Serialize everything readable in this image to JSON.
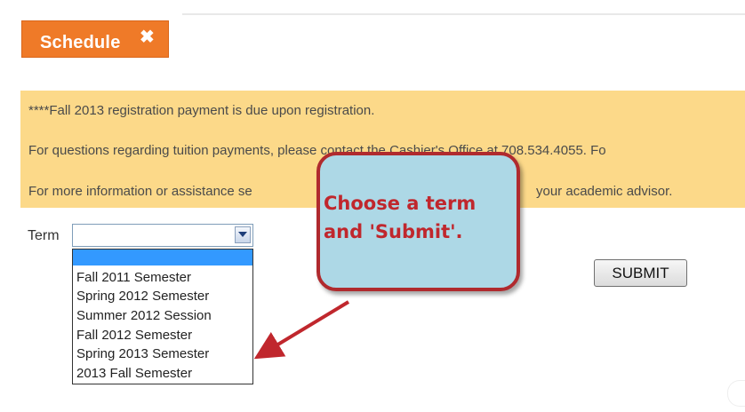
{
  "tab": {
    "label": "Schedule",
    "close_glyph": "✖"
  },
  "notice": {
    "lines": [
      "****Fall 2013 registration payment is due upon registration.",
      "For questions regarding tuition payments, please contact the Cashier's Office at 708.534.4055. Fo",
      "For more information or assistance se                                          your academic advisor."
    ],
    "line2_prefix": "For questions regarding tuition payments, please contact the Cashier's Office at 708.534.4055. Fo",
    "line3_left": "For more information or assistance se",
    "line3_right": "your academic advisor.",
    "background": "#fcd989"
  },
  "form": {
    "term_label": "Term",
    "term_selected": "",
    "term_options": [
      "",
      "Fall 2011 Semester",
      "Spring 2012 Semester",
      "Summer 2012 Session",
      "Fall 2012 Semester",
      "Spring 2013 Semester",
      "2013 Fall Semester"
    ],
    "submit_label": "SUBMIT"
  },
  "callout": {
    "line1": "Choose a term",
    "line2": "and 'Submit'.",
    "fill": "#add8e6",
    "border": "#b02a2e",
    "text_color": "#c0272d"
  },
  "colors": {
    "tab": "#ef7a28",
    "highlight": "#3399ff",
    "arrow": "#c0272d"
  },
  "icons": {
    "tab_close": "close-icon",
    "select_toggle": "chevron-down-icon"
  }
}
